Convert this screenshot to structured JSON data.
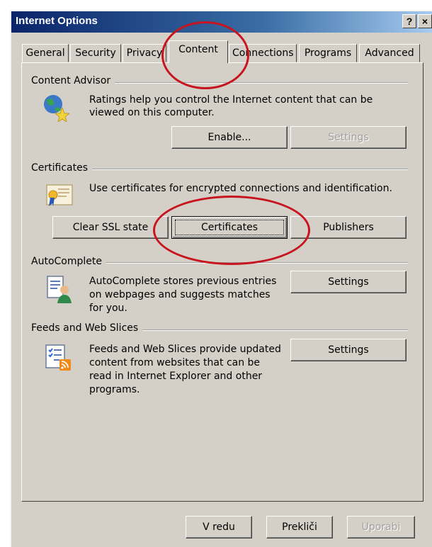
{
  "window": {
    "title": "Internet Options",
    "help_glyph": "?",
    "close_glyph": "×"
  },
  "tabs": [
    {
      "label": "General"
    },
    {
      "label": "Security"
    },
    {
      "label": "Privacy"
    },
    {
      "label": "Content",
      "active": true
    },
    {
      "label": "Connections"
    },
    {
      "label": "Programs"
    },
    {
      "label": "Advanced"
    }
  ],
  "content_advisor": {
    "title": "Content Advisor",
    "description_line1": "Ratings help you control the Internet content that can be",
    "description_line2": "viewed on this computer.",
    "enable_button": "Enable...",
    "settings_button": "Settings"
  },
  "certificates": {
    "title": "Certificates",
    "description": "Use certificates for encrypted connections and identification.",
    "clear_ssl_button": "Clear SSL state",
    "certificates_button": "Certificates",
    "publishers_button": "Publishers"
  },
  "autocomplete": {
    "title": "AutoComplete",
    "description_line1": "AutoComplete stores previous entries",
    "description_line2": "on webpages and suggests matches",
    "description_line3": "for you.",
    "settings_button": "Settings"
  },
  "feeds": {
    "title": "Feeds and Web Slices",
    "description_line1": "Feeds and Web Slices provide updated",
    "description_line2": "content from websites that can be",
    "description_line3": "read in Internet Explorer and other",
    "description_line4": "programs.",
    "settings_button": "Settings"
  },
  "footer": {
    "ok_button": "V redu",
    "cancel_button": "Prekliči",
    "apply_button": "Uporabi"
  },
  "annotation_color": "#c8141e"
}
